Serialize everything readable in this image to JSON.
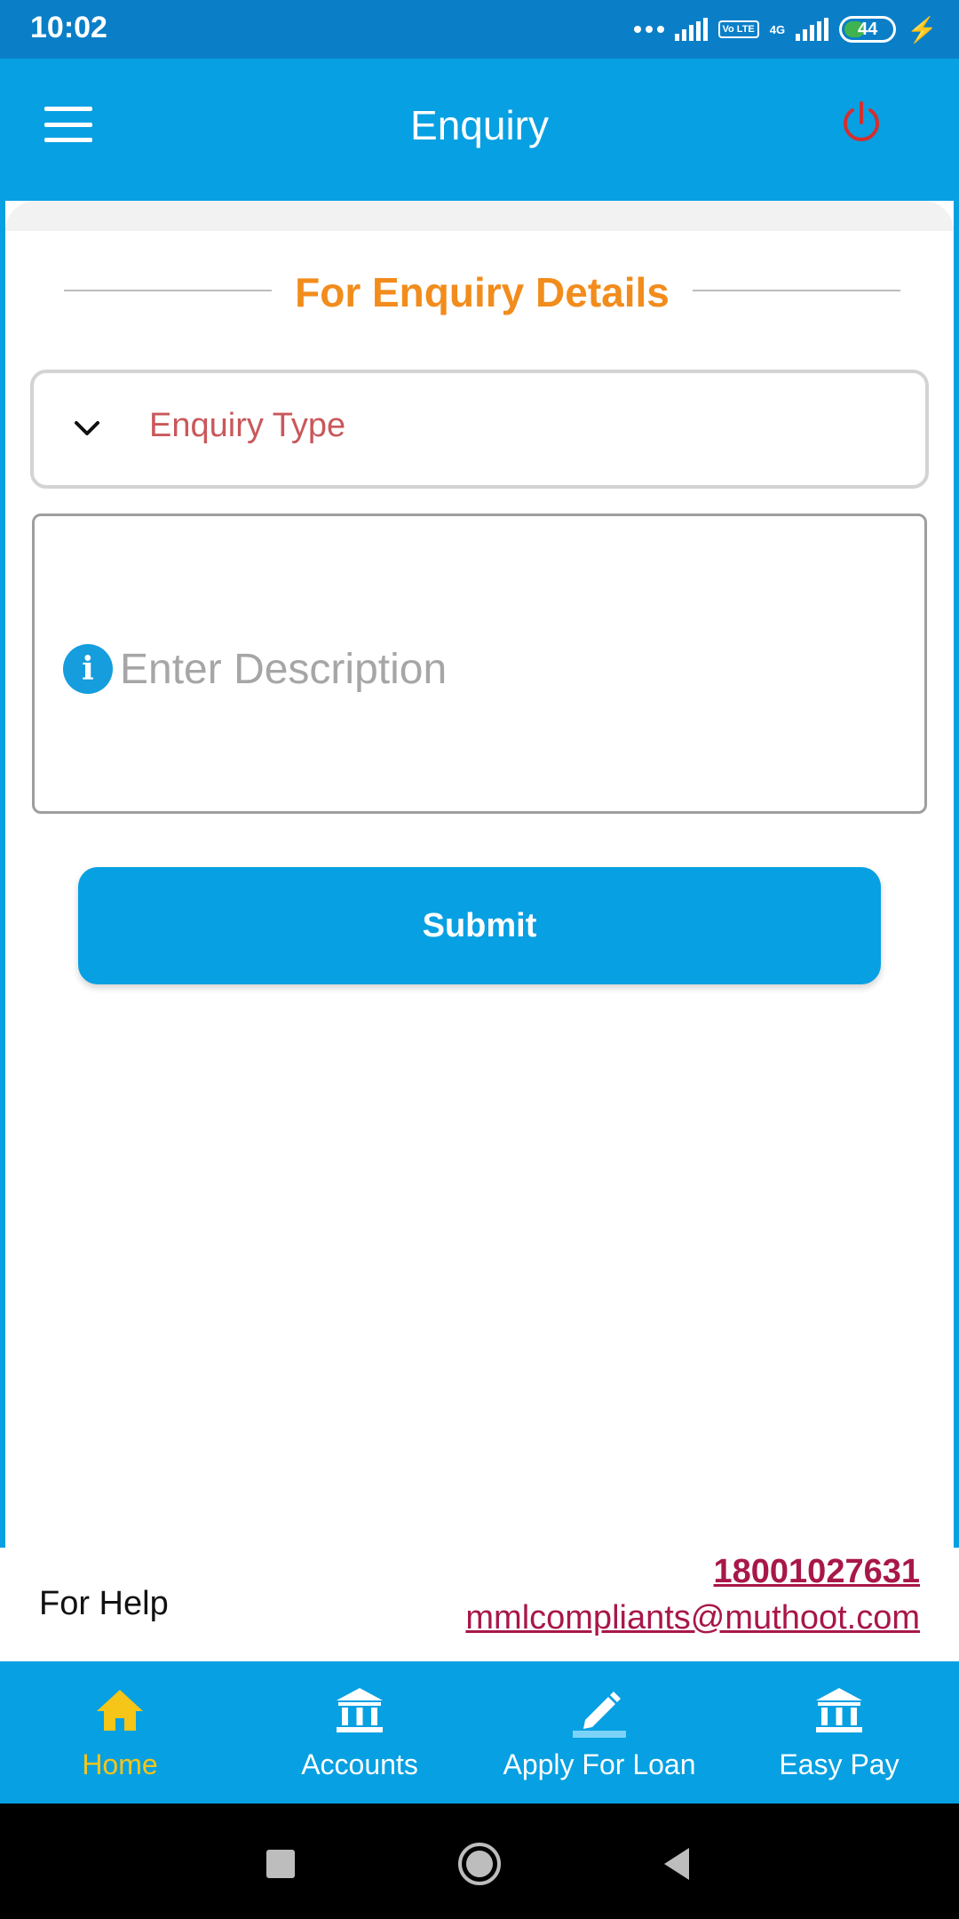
{
  "status_bar": {
    "time": "10:02",
    "network": "4G",
    "volte": "Vo LTE",
    "battery_level": "44"
  },
  "app_bar": {
    "title": "Enquiry"
  },
  "form": {
    "section_title": "For Enquiry Details",
    "enquiry_type_label": "Enquiry Type",
    "description_placeholder": "Enter Description",
    "description_value": "",
    "submit_label": "Submit"
  },
  "help": {
    "label": "For Help",
    "phone": "18001027631",
    "email": "mmlcompliants@muthoot.com"
  },
  "bottom_nav": {
    "items": [
      {
        "label": "Home",
        "icon": "home-icon",
        "active": true
      },
      {
        "label": "Accounts",
        "icon": "bank-icon",
        "active": false
      },
      {
        "label": "Apply For Loan",
        "icon": "pencil-icon",
        "active": false
      },
      {
        "label": "Easy Pay",
        "icon": "bank-icon",
        "active": false
      }
    ]
  },
  "colors": {
    "app_bar": "#07a0e2",
    "status_bar": "#0a7fc8",
    "section_title": "#f28c1c",
    "enquiry_type_label": "#c9585b",
    "link": "#a8174a",
    "nav_active": "#f5c518",
    "power_icon": "#d32f2f"
  }
}
